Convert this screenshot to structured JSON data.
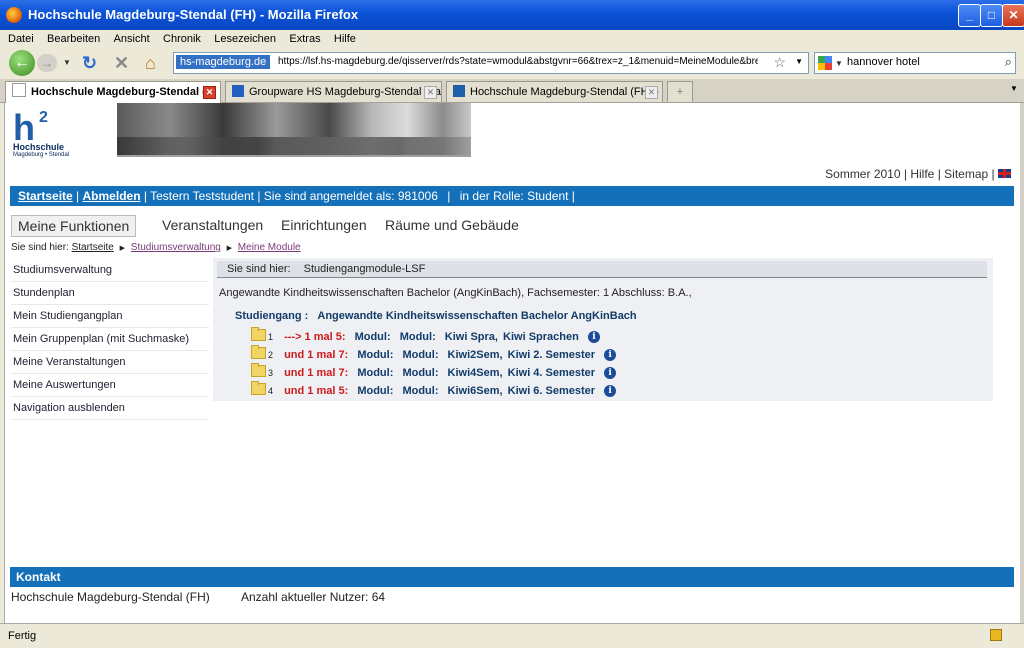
{
  "window": {
    "title": "Hochschule Magdeburg-Stendal (FH) - Mozilla Firefox",
    "min": "_",
    "max": "□",
    "close": "✕"
  },
  "menu": [
    "Datei",
    "Bearbeiten",
    "Ansicht",
    "Chronik",
    "Lesezeichen",
    "Extras",
    "Hilfe"
  ],
  "nav": {
    "back_icon": "back-arrow-icon",
    "back": "←",
    "forward": "→",
    "reload": "↻",
    "stop": "✕",
    "home": "⌂",
    "site_label": "hs-magdeburg.de",
    "url": "https://lsf.hs-magdeburg.de/qisserver/rds?state=wmodul&abstgvnr=66&trex=z_1&menuid=MeineModule&breadcru",
    "star": "☆",
    "search_value": "hannover hotel",
    "search_icon": "⌕"
  },
  "tabs": [
    {
      "label": "Hochschule Magdeburg-Stendal (..."
    },
    {
      "label": "Groupware HS Magdeburg-Stendal [Kal..."
    },
    {
      "label": "Hochschule Magdeburg-Stendal (FH) - ..."
    }
  ],
  "page": {
    "logo": {
      "h": "h",
      "sup": "2",
      "line1": "Hochschule",
      "line2": "Magdeburg • Stendal"
    },
    "toplinks": {
      "semester": "Sommer 2010",
      "sep1": "|",
      "help": "Hilfe",
      "sep2": "|",
      "sitemap": "Sitemap",
      "sep3": "|"
    },
    "bluebar": {
      "start": "Startseite",
      "sep1": "|",
      "logout": "Abmelden",
      "sep2": "|",
      "user": "Testern Teststudent",
      "sep3": "|",
      "logged_in": "Sie sind angemeldet als: 981006",
      "sep4": "|",
      "role": "in der Rolle: Student",
      "sep5": "|"
    },
    "main_tabs": [
      "Meine Funktionen",
      "Veranstaltungen",
      "Einrichtungen",
      "Räume und Gebäude"
    ],
    "breadcrumb": {
      "prefix": "Sie sind hier:",
      "items": [
        "Startseite",
        "Studiumsverwaltung",
        "Meine Module"
      ]
    },
    "sidebar": [
      "Studiumsverwaltung",
      "Stundenplan",
      "Mein Studiengangplan",
      "Mein Gruppenplan (mit Suchmaske)",
      "Meine Veranstaltungen",
      "Meine Auswertungen",
      "Navigation ausblenden"
    ],
    "panel": {
      "header_prefix": "Sie sind hier:",
      "header_value": "Studiengangmodule-LSF",
      "description": "Angewandte Kindheitswissenschaften Bachelor (AngKinBach), Fachsemester: 1 Abschluss: B.A.,",
      "studiengang_label": "Studiengang :",
      "studiengang_value": "Angewandte Kindheitswissenschaften Bachelor AngKinBach",
      "modules": [
        {
          "num": "1",
          "rule": "---> 1 mal 5:",
          "m1": "Modul:",
          "m2": "Modul:",
          "code": "Kiwi Spra,",
          "name": "Kiwi Sprachen"
        },
        {
          "num": "2",
          "rule": "und 1 mal 7:",
          "m1": "Modul:",
          "m2": "Modul:",
          "code": "Kiwi2Sem,",
          "name": "Kiwi 2. Semester"
        },
        {
          "num": "3",
          "rule": "und 1 mal 7:",
          "m1": "Modul:",
          "m2": "Modul:",
          "code": "Kiwi4Sem,",
          "name": "Kiwi 4. Semester"
        },
        {
          "num": "4",
          "rule": "und 1 mal 5:",
          "m1": "Modul:",
          "m2": "Modul:",
          "code": "Kiwi6Sem,",
          "name": "Kiwi 6. Semester"
        }
      ],
      "info_glyph": "i"
    },
    "kontakt": "Kontakt",
    "footer_left": "Hochschule Magdeburg-Stendal (FH)",
    "footer_right": "Anzahl aktueller Nutzer: 64"
  },
  "status": "Fertig",
  "colors": {
    "accent": "#1470b8",
    "rule_red": "#cc1a1a",
    "module_blue": "#123c6a"
  }
}
